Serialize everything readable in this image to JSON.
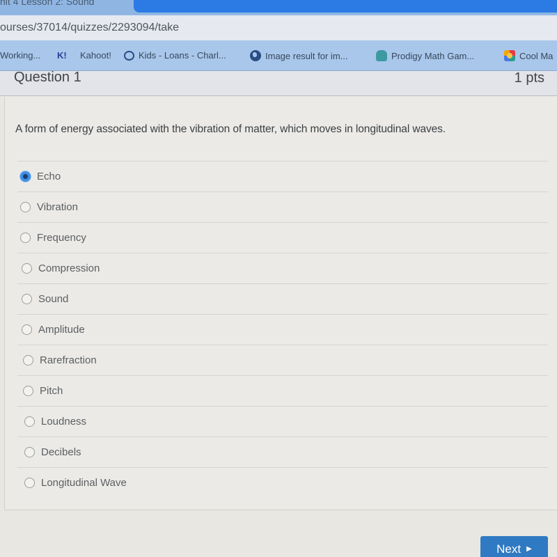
{
  "browser": {
    "tab_title": "nit 4 Lesson 2: Sound",
    "url": "ourses/37014/quizzes/2293094/take",
    "bookmarks": [
      {
        "label": "Working...",
        "icon": "page-icon"
      },
      {
        "label": "K!",
        "icon": "kahoot-icon"
      },
      {
        "label": "Kahoot!",
        "icon": "kahoot-icon"
      },
      {
        "label": "Kids - Loans - Charl...",
        "icon": "circle-icon"
      },
      {
        "label": "Image result for im...",
        "icon": "globe-icon"
      },
      {
        "label": "Prodigy Math Gam...",
        "icon": "prodigy-icon"
      },
      {
        "label": "Cool Ma",
        "icon": "coolmath-icon"
      }
    ]
  },
  "question": {
    "title": "Question 1",
    "points": "1 pts",
    "text": "A form of energy associated with the vibration of matter, which moves in longitudinal waves.",
    "answers": [
      {
        "label": "Echo",
        "selected": true
      },
      {
        "label": "Vibration",
        "selected": false
      },
      {
        "label": "Frequency",
        "selected": false
      },
      {
        "label": "Compression",
        "selected": false
      },
      {
        "label": "Sound",
        "selected": false
      },
      {
        "label": "Amplitude",
        "selected": false
      },
      {
        "label": "Rarefraction",
        "selected": false
      },
      {
        "label": "Pitch",
        "selected": false
      },
      {
        "label": "Loudness",
        "selected": false
      },
      {
        "label": "Decibels",
        "selected": false
      },
      {
        "label": "Longitudinal Wave",
        "selected": false
      }
    ]
  },
  "footer": {
    "next_label": "Next",
    "next_icon": "play-arrow-icon"
  },
  "colors": {
    "accent": "#2f7ac3",
    "selected_radio": "#3e8ee6",
    "bookmark_bar": "#a9c7ea"
  }
}
